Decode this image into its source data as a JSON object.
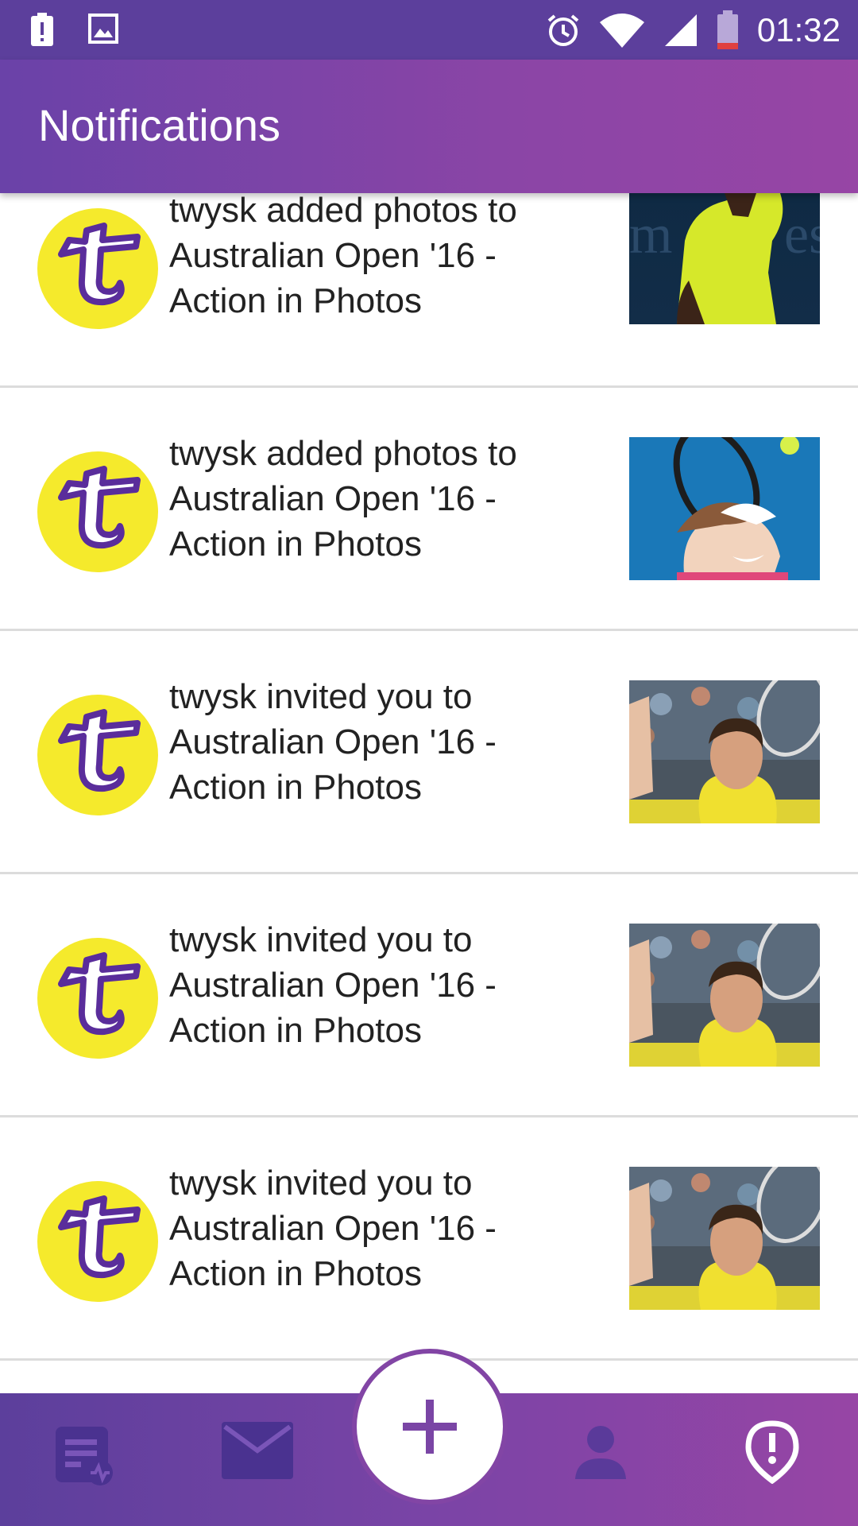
{
  "status_bar": {
    "time": "01:32",
    "icons": [
      "battery-alert-icon",
      "image-icon",
      "alarm-icon",
      "wifi-icon",
      "signal-icon",
      "battery-icon"
    ]
  },
  "app_bar": {
    "title": "Notifications"
  },
  "notifications": [
    {
      "text": "twysk added photos to Australian Open '16 - Action in Photos",
      "thumb": "player-yellow-dress"
    },
    {
      "text": "twysk added photos to Australian Open '16 - Action in Photos",
      "thumb": "player-racket-ball"
    },
    {
      "text": "twysk invited you to Australian Open '16 - Action in Photos",
      "thumb": "player-yellow-shirt"
    },
    {
      "text": "twysk invited you to Australian Open '16 - Action in Photos",
      "thumb": "player-yellow-shirt"
    },
    {
      "text": "twysk invited you to Australian Open '16 - Action in Photos",
      "thumb": "player-yellow-shirt"
    }
  ],
  "bottom_nav": {
    "items": [
      "feed-icon",
      "mail-icon",
      "add-icon",
      "profile-icon",
      "alert-icon"
    ]
  },
  "colors": {
    "primary": "#5c3f9c",
    "accent": "#9745a5",
    "avatar_bg": "#f5ea2c"
  }
}
